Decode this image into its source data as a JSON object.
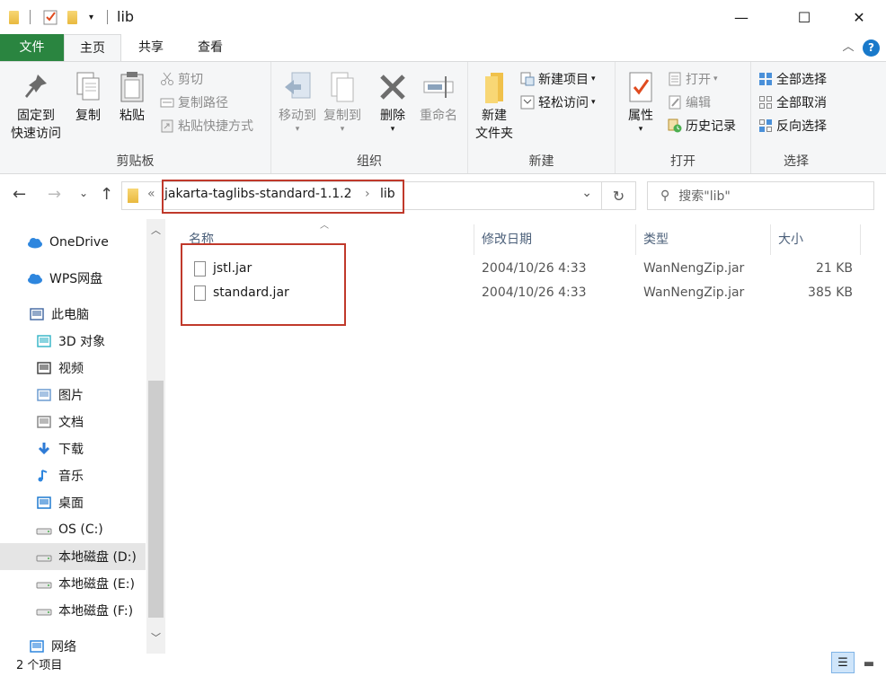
{
  "window": {
    "title": "lib",
    "minimize": "—",
    "maximize": "☐",
    "close": "✕"
  },
  "tabs": [
    "文件",
    "主页",
    "共享",
    "查看"
  ],
  "ribbon": {
    "clipboard": {
      "pin": "固定到\n快速访问",
      "pin_l1": "固定到",
      "pin_l2": "快速访问",
      "copy": "复制",
      "paste": "粘贴",
      "cut": "剪切",
      "copy_path": "复制路径",
      "paste_shortcut": "粘贴快捷方式",
      "label": "剪贴板"
    },
    "organize": {
      "move_to": "移动到",
      "copy_to": "复制到",
      "delete": "删除",
      "rename": "重命名",
      "label": "组织"
    },
    "new": {
      "new_folder_l1": "新建",
      "new_folder_l2": "文件夹",
      "new_item": "新建项目",
      "easy_access": "轻松访问",
      "label": "新建"
    },
    "open": {
      "properties": "属性",
      "open": "打开",
      "edit": "编辑",
      "history": "历史记录",
      "label": "打开"
    },
    "select": {
      "select_all": "全部选择",
      "select_none": "全部取消",
      "invert": "反向选择",
      "label": "选择"
    }
  },
  "address": {
    "overflow": "«",
    "crumbs": [
      "jakarta-taglibs-standard-1.1.2",
      "lib"
    ],
    "separator": "›",
    "search_placeholder": "搜索\"lib\""
  },
  "sidebar": {
    "items": [
      {
        "label": "OneDrive",
        "icon": "cloud-icon"
      },
      {
        "label": "WPS网盘",
        "icon": "cloud-icon"
      },
      {
        "label": "此电脑",
        "icon": "computer-icon"
      },
      {
        "label": "3D 对象",
        "icon": "cube-icon"
      },
      {
        "label": "视频",
        "icon": "film-icon"
      },
      {
        "label": "图片",
        "icon": "picture-icon"
      },
      {
        "label": "文档",
        "icon": "document-icon"
      },
      {
        "label": "下载",
        "icon": "download-icon"
      },
      {
        "label": "音乐",
        "icon": "music-icon"
      },
      {
        "label": "桌面",
        "icon": "desktop-icon"
      },
      {
        "label": "OS (C:)",
        "icon": "windows-drive-icon"
      },
      {
        "label": "本地磁盘 (D:)",
        "icon": "drive-icon"
      },
      {
        "label": "本地磁盘 (E:)",
        "icon": "drive-icon"
      },
      {
        "label": "本地磁盘 (F:)",
        "icon": "drive-icon"
      },
      {
        "label": "网络",
        "icon": "network-icon"
      }
    ]
  },
  "columns": [
    "名称",
    "修改日期",
    "类型",
    "大小"
  ],
  "files": [
    {
      "name": "jstl.jar",
      "modified": "2004/10/26 4:33",
      "type": "WanNengZip.jar",
      "size": "21 KB"
    },
    {
      "name": "standard.jar",
      "modified": "2004/10/26 4:33",
      "type": "WanNengZip.jar",
      "size": "385 KB"
    }
  ],
  "status": {
    "count": "2 个项目"
  },
  "colors": {
    "file_tab": "#2a8540",
    "highlight_box": "#c0392b",
    "selected_nav": "#e5e5e5"
  }
}
